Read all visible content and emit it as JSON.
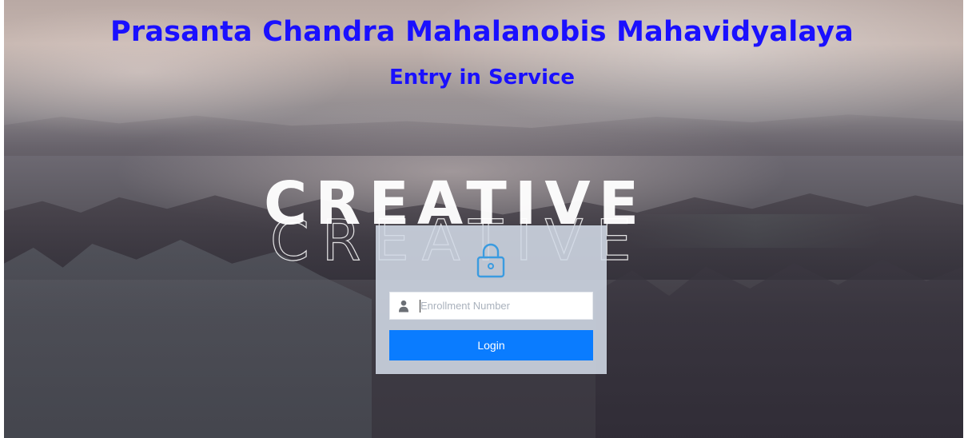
{
  "header": {
    "title": "Prasanta Chandra Mahalanobis Mahavidyalaya",
    "subtitle": "Entry in Service"
  },
  "background": {
    "wordmark": "CREATIVE"
  },
  "login_form": {
    "icon": "lock-icon",
    "field_icon": "user-icon",
    "enrollment_placeholder": "Enrollment Number",
    "enrollment_value": "",
    "submit_label": "Login"
  },
  "colors": {
    "heading": "#1a10ff",
    "button": "#0a7cff",
    "lock_icon": "#3a9be0",
    "card": "#d2dae6"
  }
}
